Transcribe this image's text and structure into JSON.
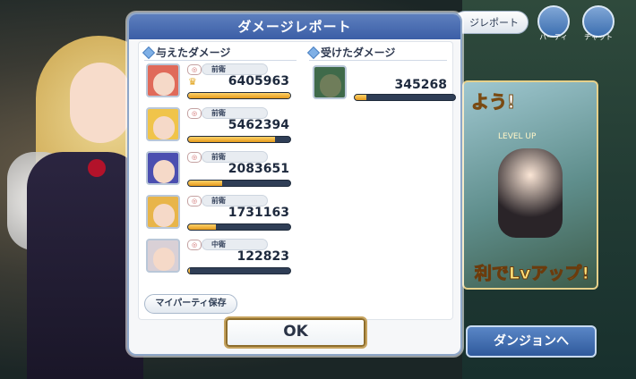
{
  "dialog": {
    "title": "ダメージレポート",
    "dealt_header": "与えたダメージ",
    "taken_header": "受けたダメージ",
    "party_save_label": "マイパーティ保存",
    "ok_label": "OK"
  },
  "dealt": [
    {
      "position": "前衛",
      "damage": "6405963",
      "bar_fraction": 1.0,
      "crown": "♛",
      "portrait_color": "#e06a5a"
    },
    {
      "position": "前衛",
      "damage": "5462394",
      "bar_fraction": 0.85,
      "portrait_color": "#f0c44a"
    },
    {
      "position": "前衛",
      "damage": "2083651",
      "bar_fraction": 0.33,
      "portrait_color": "#4b4fb0"
    },
    {
      "position": "前衛",
      "damage": "1731163",
      "bar_fraction": 0.27,
      "portrait_color": "#e8b54a"
    },
    {
      "position": "中衛",
      "damage": "122823",
      "bar_fraction": 0.02,
      "portrait_color": "#d9d0d6"
    }
  ],
  "taken": [
    {
      "damage": "345268",
      "bar_fraction": 0.12,
      "portrait_color": "#3f6a4a"
    }
  ],
  "background": {
    "report_button": "ジレポート",
    "party_label": "パーティ",
    "chat_label": "チャット",
    "banner_top": "よう!",
    "banner_level": "LEVEL UP",
    "banner_bottom": "利でLvアップ!",
    "dungeon_button": "ダンジョンへ"
  }
}
